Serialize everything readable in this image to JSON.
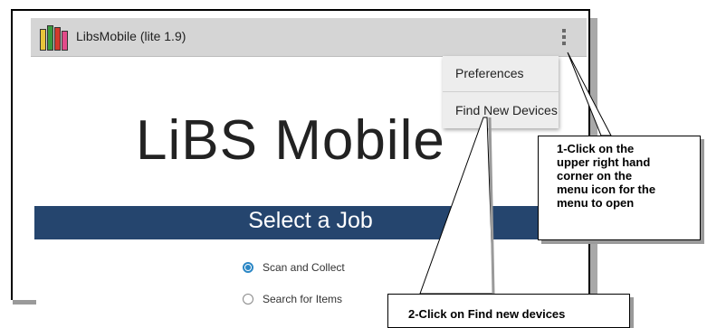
{
  "app": {
    "title": "LibsMobile (lite 1.9)",
    "colors": {
      "action_bar": "#d5d5d5",
      "band": "#25456e",
      "radio_accent": "#2c87c5"
    },
    "icons": [
      "app-logo-icon",
      "overflow-menu-icon"
    ]
  },
  "menu": {
    "items": [
      {
        "label": "Preferences"
      },
      {
        "label": "Find New Devices"
      }
    ]
  },
  "main": {
    "hero_title": "LiBS Mobile",
    "job_header": "Select a Job",
    "options": [
      {
        "label": "Scan and Collect",
        "selected": true
      },
      {
        "label": "Search for Items",
        "selected": false
      }
    ]
  },
  "callouts": {
    "step1": "1-Click on the\nupper right hand\ncorner on the\nmenu icon for the\nmenu to open",
    "step2": "2-Click on Find new devices"
  }
}
